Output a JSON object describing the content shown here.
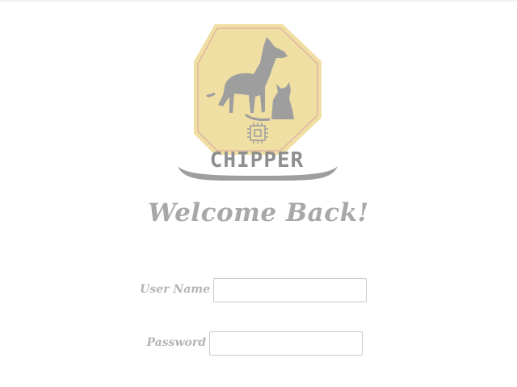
{
  "header": {
    "logo": {
      "icon": "dog-cat-chip-logo-icon",
      "brand_name": "CHIPPER",
      "badge_color": "#f0dfa3",
      "badge_border_color": "#d9a3a3",
      "silhouette_color": "#9e9e9e"
    }
  },
  "main": {
    "title": "Welcome Back!"
  },
  "form": {
    "username": {
      "label": "User Name",
      "value": "",
      "placeholder": ""
    },
    "password": {
      "label": "Password",
      "value": "",
      "placeholder": ""
    }
  }
}
